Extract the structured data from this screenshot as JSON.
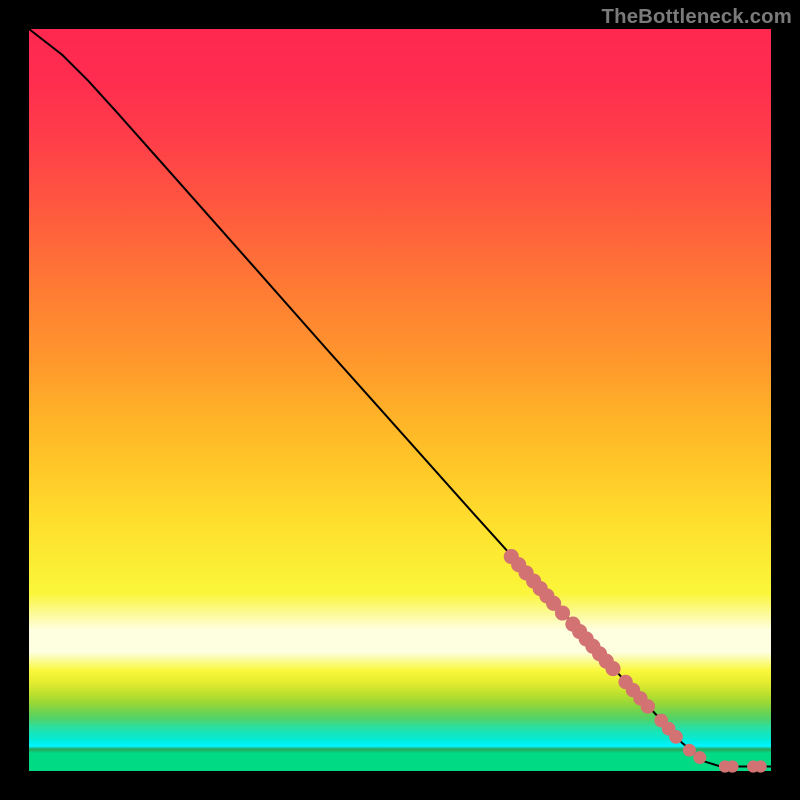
{
  "watermark": "TheBottleneck.com",
  "colors": {
    "black": "#000000",
    "curve": "#000000",
    "marker_fill": "#d37272",
    "marker_stroke": "#c25d5d"
  },
  "chart_data": {
    "type": "line",
    "title": "",
    "xlabel": "",
    "ylabel": "",
    "xlim": [
      0,
      100
    ],
    "ylim": [
      0,
      100
    ],
    "grid": false,
    "legend": false,
    "note": "No axes or tick labels are visible; values are normalized 0–100 estimates from pixel positions.",
    "curve": [
      {
        "x": 0.0,
        "y": 100.0
      },
      {
        "x": 4.5,
        "y": 96.5
      },
      {
        "x": 8.0,
        "y": 93.0
      },
      {
        "x": 12.0,
        "y": 88.6
      },
      {
        "x": 20.0,
        "y": 79.6
      },
      {
        "x": 30.0,
        "y": 68.3
      },
      {
        "x": 40.0,
        "y": 57.0
      },
      {
        "x": 50.0,
        "y": 45.8
      },
      {
        "x": 60.0,
        "y": 34.6
      },
      {
        "x": 70.0,
        "y": 23.5
      },
      {
        "x": 80.0,
        "y": 12.5
      },
      {
        "x": 88.0,
        "y": 3.8
      },
      {
        "x": 91.0,
        "y": 1.3
      },
      {
        "x": 93.2,
        "y": 0.6
      },
      {
        "x": 100.0,
        "y": 0.6
      }
    ],
    "markers": [
      {
        "x": 65.0,
        "y": 28.9,
        "r": 1.05
      },
      {
        "x": 66.0,
        "y": 27.8,
        "r": 1.05
      },
      {
        "x": 67.0,
        "y": 26.7,
        "r": 1.05
      },
      {
        "x": 68.0,
        "y": 25.6,
        "r": 1.05
      },
      {
        "x": 68.9,
        "y": 24.6,
        "r": 1.05
      },
      {
        "x": 69.8,
        "y": 23.6,
        "r": 1.05
      },
      {
        "x": 70.7,
        "y": 22.6,
        "r": 1.05
      },
      {
        "x": 71.9,
        "y": 21.3,
        "r": 1.05
      },
      {
        "x": 73.3,
        "y": 19.8,
        "r": 1.05
      },
      {
        "x": 74.2,
        "y": 18.8,
        "r": 1.05
      },
      {
        "x": 75.1,
        "y": 17.8,
        "r": 1.05
      },
      {
        "x": 76.0,
        "y": 16.8,
        "r": 1.05
      },
      {
        "x": 76.9,
        "y": 15.8,
        "r": 1.05
      },
      {
        "x": 77.8,
        "y": 14.8,
        "r": 1.05
      },
      {
        "x": 78.7,
        "y": 13.8,
        "r": 1.05
      },
      {
        "x": 80.4,
        "y": 12.0,
        "r": 1.0
      },
      {
        "x": 81.4,
        "y": 10.9,
        "r": 1.0
      },
      {
        "x": 82.4,
        "y": 9.8,
        "r": 1.0
      },
      {
        "x": 83.4,
        "y": 8.7,
        "r": 1.0
      },
      {
        "x": 85.2,
        "y": 6.8,
        "r": 0.95
      },
      {
        "x": 86.2,
        "y": 5.7,
        "r": 0.95
      },
      {
        "x": 87.2,
        "y": 4.6,
        "r": 0.95
      },
      {
        "x": 89.0,
        "y": 2.8,
        "r": 0.9
      },
      {
        "x": 90.4,
        "y": 1.8,
        "r": 0.9
      },
      {
        "x": 93.8,
        "y": 0.6,
        "r": 0.85
      },
      {
        "x": 94.8,
        "y": 0.6,
        "r": 0.85
      },
      {
        "x": 97.6,
        "y": 0.6,
        "r": 0.85
      },
      {
        "x": 98.6,
        "y": 0.6,
        "r": 0.85
      }
    ]
  }
}
